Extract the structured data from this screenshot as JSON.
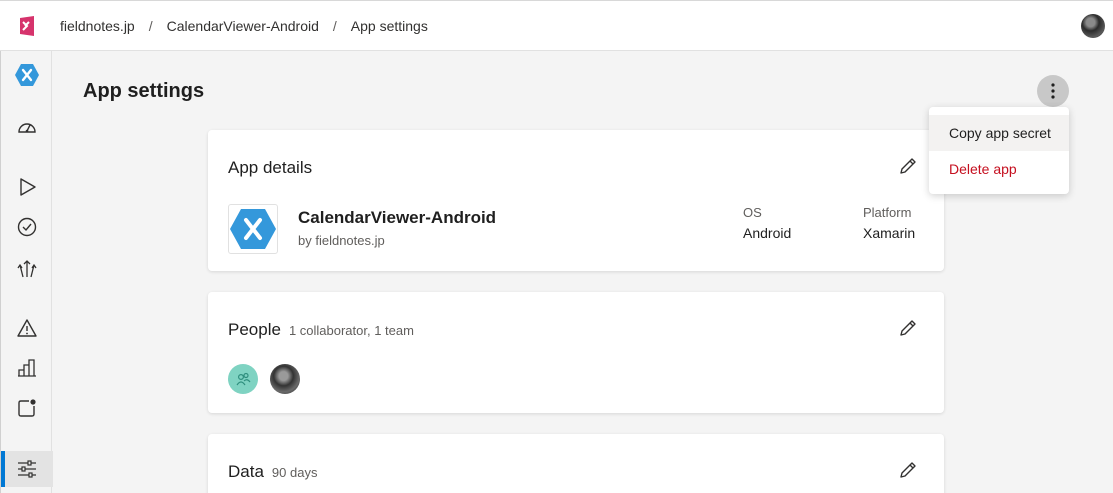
{
  "breadcrumb": {
    "items": [
      "fieldnotes.jp",
      "CalendarViewer-Android",
      "App settings"
    ],
    "separator": "/"
  },
  "page": {
    "title": "App settings"
  },
  "sidebar": {
    "items": [
      {
        "name": "app",
        "icon": "xamarin-hex-icon"
      },
      {
        "name": "overview",
        "icon": "gauge-icon"
      },
      {
        "name": "build",
        "icon": "play-icon"
      },
      {
        "name": "test",
        "icon": "check-circle-icon"
      },
      {
        "name": "distribute",
        "icon": "distribute-icon"
      },
      {
        "name": "diagnostics",
        "icon": "warning-icon"
      },
      {
        "name": "analytics",
        "icon": "bar-chart-icon"
      },
      {
        "name": "push",
        "icon": "notification-icon"
      },
      {
        "name": "settings",
        "icon": "sliders-icon",
        "active": true
      }
    ]
  },
  "app_details": {
    "title": "App details",
    "app_name": "CalendarViewer-Android",
    "owner": "by fieldnotes.jp",
    "os_label": "OS",
    "os_value": "Android",
    "platform_label": "Platform",
    "platform_value": "Xamarin"
  },
  "people": {
    "title": "People",
    "subtitle": "1 collaborator, 1 team"
  },
  "data": {
    "title": "Data",
    "subtitle": "90 days"
  },
  "menu": {
    "copy_secret": "Copy app secret",
    "delete_app": "Delete app"
  },
  "colors": {
    "accent": "#0078d4",
    "danger": "#c50f1f",
    "xamarin": "#3498db",
    "brand": "#d6336c"
  }
}
